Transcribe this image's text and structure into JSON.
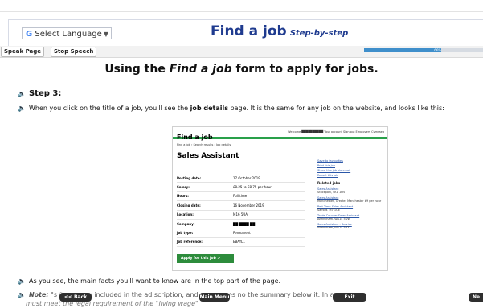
{
  "header": {
    "language": {
      "g": "G",
      "label": "Select Language",
      "arrow": "▼"
    },
    "title": "Find a job",
    "subtitle": "Step-by-step"
  },
  "toolbar": {
    "speak": "Speak Page",
    "stop": "Stop Speech",
    "progress_label": "66%",
    "progress_value": 0.65
  },
  "heading": {
    "pre": "Using the ",
    "em": "Find a job",
    "post": " form to apply for jobs."
  },
  "step": "Step 3:",
  "para": {
    "pre": "When you click on the title of a job, you'll see the ",
    "bold": "job details",
    "post": " page. It is the same for any job on the website, and looks like this:"
  },
  "shot": {
    "brand": "Find a job",
    "nav_links": "Welcome ██████████   Your account   Sign out   Employers   Cymraeg",
    "breadcrumb": "Find a job › Search results › Job details",
    "job_title": "Sales Assistant",
    "rows": [
      {
        "k": "Posting date:",
        "v": "17 October 2019"
      },
      {
        "k": "Salary:",
        "v": "£8.25 to £8.75 per hour"
      },
      {
        "k": "Hours:",
        "v": "Full time"
      },
      {
        "k": "Closing date:",
        "v": "16 November 2019"
      },
      {
        "k": "Location:",
        "v": "M16 5UA"
      },
      {
        "k": "Company:",
        "v": "██ ████ ██"
      },
      {
        "k": "Job type:",
        "v": "Permanent"
      },
      {
        "k": "Job reference:",
        "v": "EBAYL1"
      }
    ],
    "apply": "Apply for this job  >",
    "side_links": [
      "Save to favourites",
      "Print this job",
      "Share this job via email",
      "Report this job"
    ],
    "related_heading": "Related jobs",
    "related": [
      {
        "t": "Sales Assistant",
        "p": "Stockport, SK1 1PN"
      },
      {
        "t": "Sales Assistant",
        "p": "Manchester, Greater Manchester £9 per hour"
      },
      {
        "t": "Part Time Sales Assistant",
        "p": "Salford, M7 1QE"
      },
      {
        "t": "Trade Counter Sales Assistant",
        "p": "Altrincham, WA14 5DW"
      },
      {
        "t": "Sales Assistant - Service",
        "p": "Altrincham, WA14 5RZ"
      }
    ]
  },
  "line1": "As you see, the main facts you'll want to know are in the top part of the page.",
  "line2": {
    "note": "Note:",
    "rest": " \"s              OT always included in the ad              scription, and sometimes no               the summary below it. In any"
  },
  "line3": "must meet the legal requirement of the \"living wage\"",
  "overlay": {
    "back": "<< Back",
    "menu": "Main Menu",
    "exit": "Exit",
    "next": "Ne"
  }
}
